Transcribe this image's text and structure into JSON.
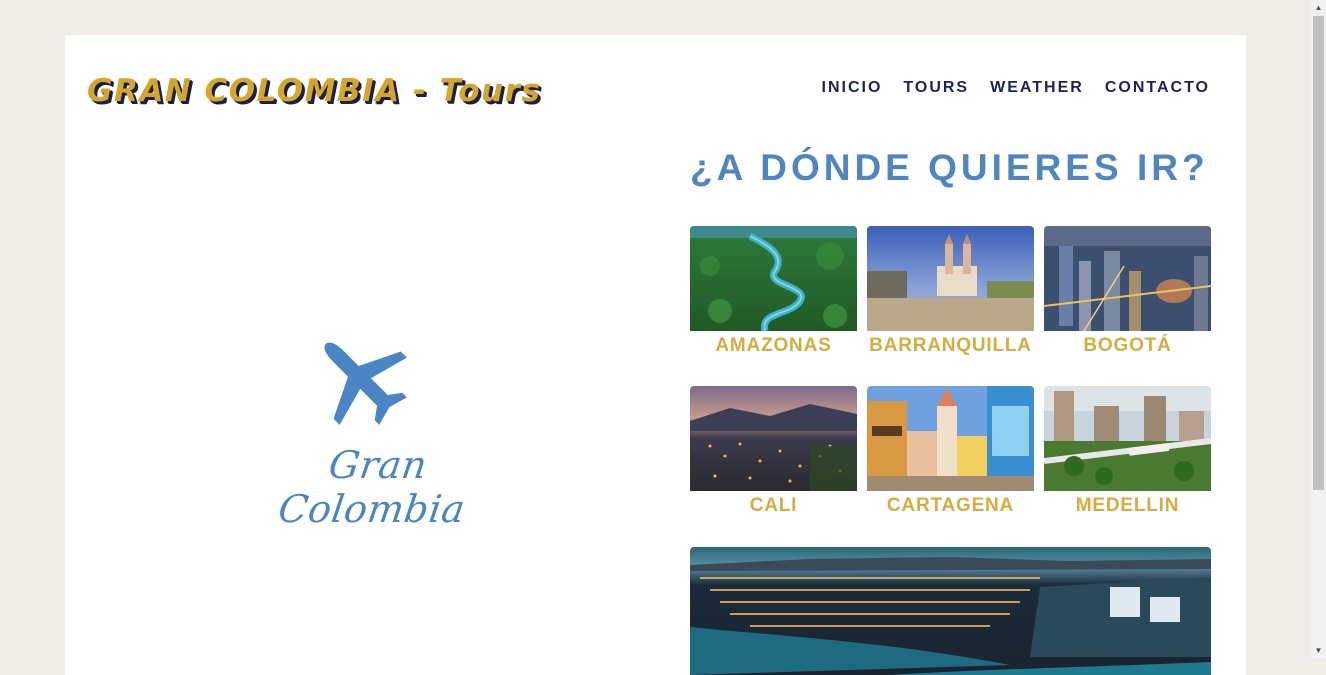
{
  "header": {
    "brand": "GRAN COLOMBIA - Tours",
    "nav": [
      "INICIO",
      "TOURS",
      "WEATHER",
      "CONTACTO"
    ]
  },
  "logo": {
    "text": "Gran Colombia",
    "icon": "airplane-icon",
    "color": "#4a86c4"
  },
  "main": {
    "heading": "¿A DÓNDE QUIERES IR?",
    "destinations": [
      {
        "label": "AMAZONAS"
      },
      {
        "label": "BARRANQUILLA"
      },
      {
        "label": "BOGOTÁ"
      },
      {
        "label": "CALI"
      },
      {
        "label": "CARTAGENA"
      },
      {
        "label": "MEDELLIN"
      }
    ]
  },
  "colors": {
    "background": "#f0ece7",
    "brand_gold": "#d4a72c",
    "nav_navy": "#1a2455",
    "heading_blue": "#4f86c1",
    "label_gold": "#d5ac3d"
  }
}
